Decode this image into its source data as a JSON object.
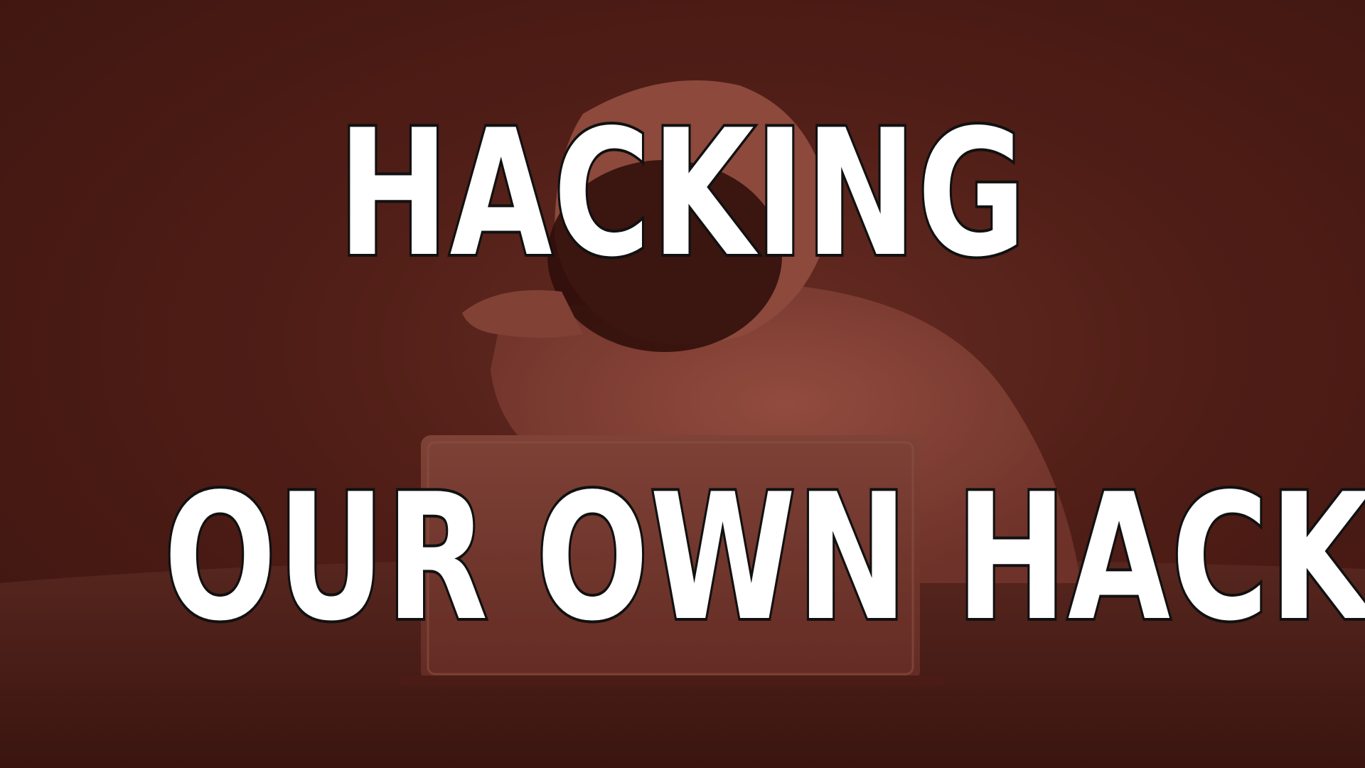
{
  "image": {
    "description_icon": "hooded-hacker-at-laptop",
    "tint_color": "#5a2119"
  },
  "headline": {
    "line1": "HACKING",
    "line2": "OUR OWN HACK?",
    "text_color": "#ffffff",
    "outline_color": "#111111"
  }
}
